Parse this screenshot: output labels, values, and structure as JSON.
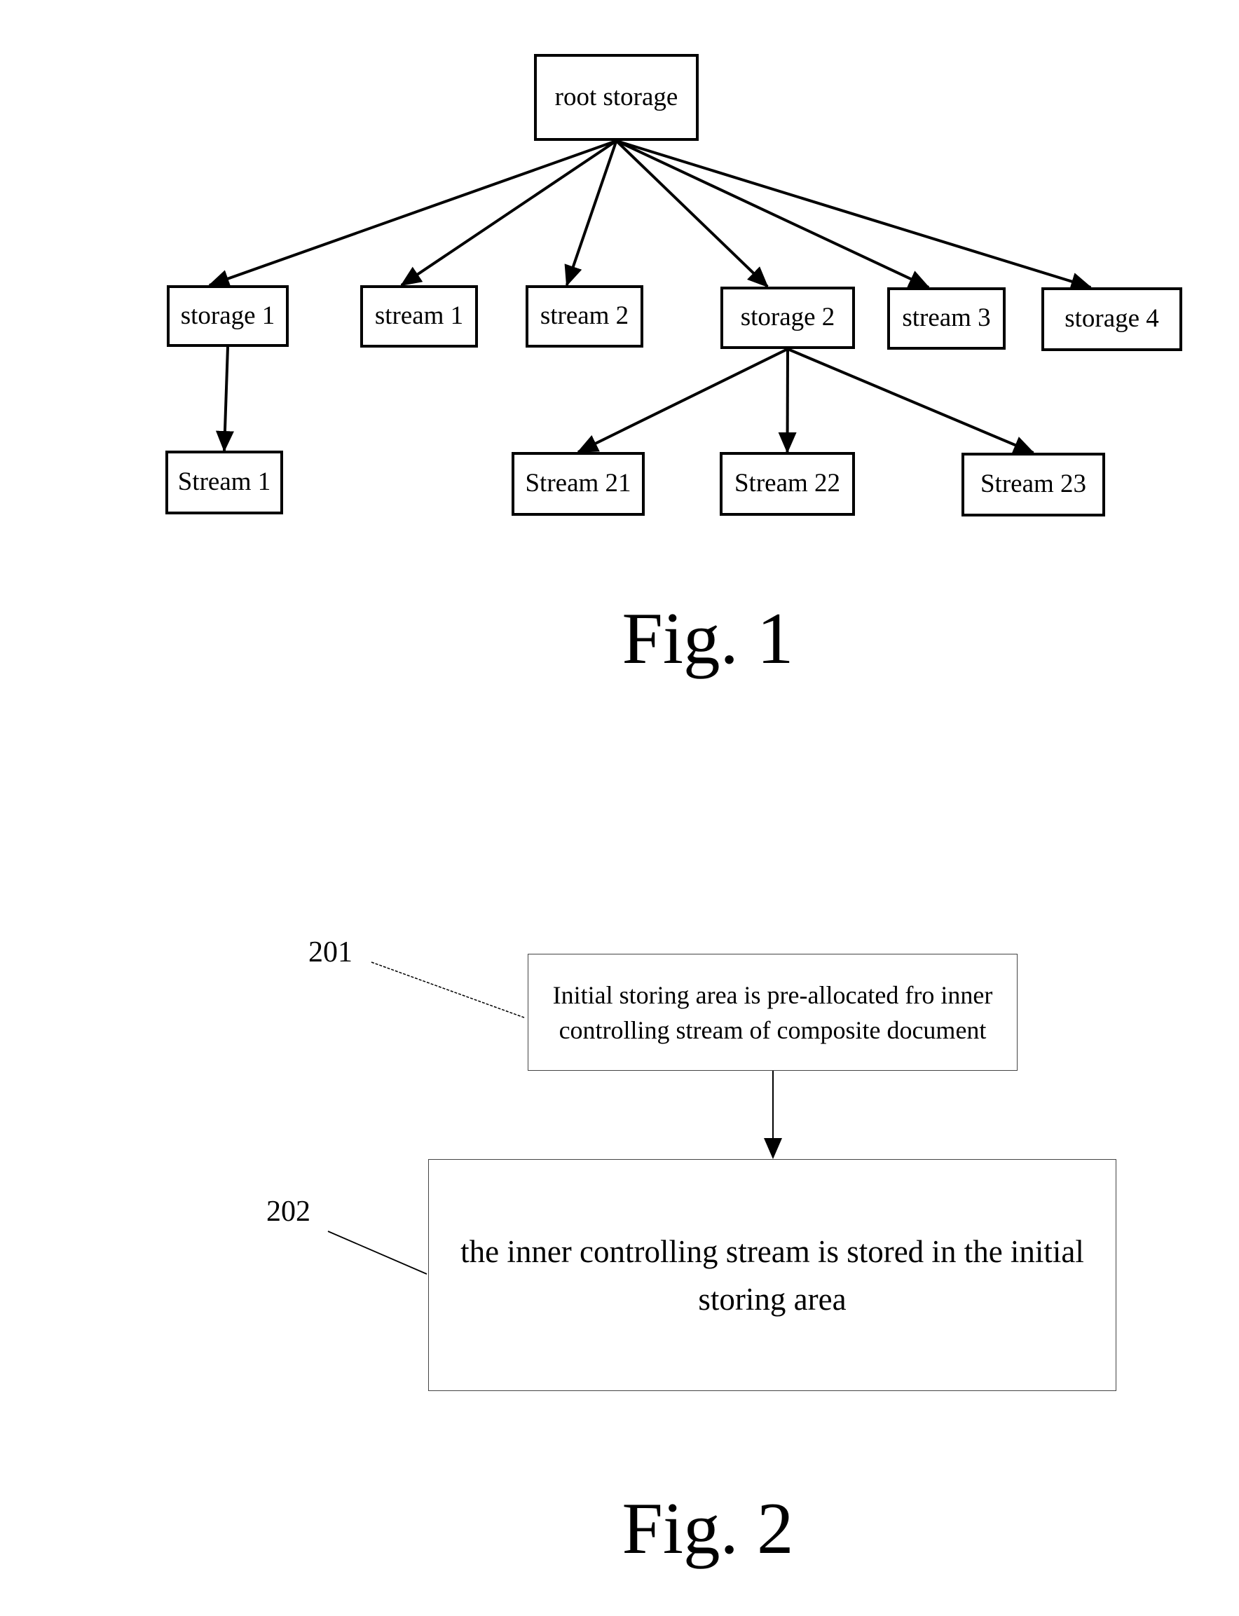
{
  "fig1": {
    "caption": "Fig. 1",
    "nodes": {
      "root": "root storage",
      "storage1": "storage 1",
      "stream1": "stream 1",
      "stream2": "stream 2",
      "storage2": "storage 2",
      "stream3": "stream 3",
      "storage4": "storage 4",
      "Stream1_child": "Stream 1",
      "Stream21": "Stream 21",
      "Stream22": "Stream 22",
      "Stream23": "Stream 23"
    },
    "edges": [
      [
        "root",
        "storage1"
      ],
      [
        "root",
        "stream1"
      ],
      [
        "root",
        "stream2"
      ],
      [
        "root",
        "storage2"
      ],
      [
        "root",
        "stream3"
      ],
      [
        "root",
        "storage4"
      ],
      [
        "storage1",
        "Stream1_child"
      ],
      [
        "storage2",
        "Stream21"
      ],
      [
        "storage2",
        "Stream22"
      ],
      [
        "storage2",
        "Stream23"
      ]
    ]
  },
  "fig2": {
    "caption": "Fig. 2",
    "steps": [
      {
        "ref": "201",
        "text": "Initial storing area is pre-allocated fro inner controlling stream of composite document"
      },
      {
        "ref": "202",
        "text": "the inner controlling stream is stored in the initial storing area"
      }
    ]
  }
}
